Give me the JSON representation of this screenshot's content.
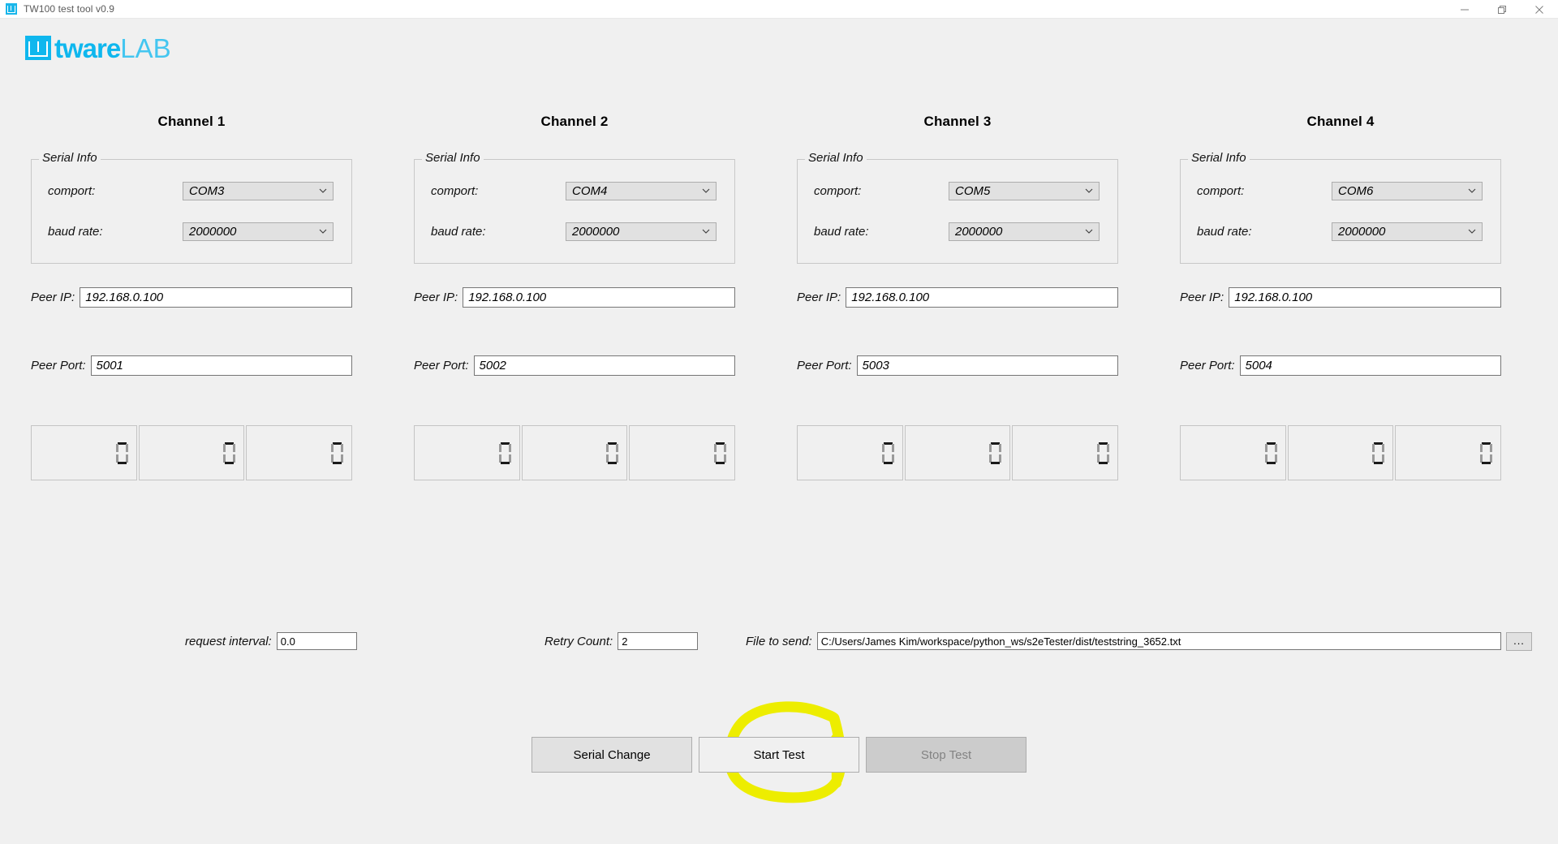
{
  "window": {
    "title": "TW100 test tool v0.9",
    "app_icon": "tw-logo-icon",
    "minimize_label": "minimize-icon",
    "maximize_label": "maximize-icon",
    "close_label": "close-icon"
  },
  "brand": {
    "mark": "tware-logo-icon",
    "name_bold": "tware",
    "name_light": "LAB",
    "color": "#0fb7ee"
  },
  "channels": [
    {
      "title": "Channel 1",
      "serial_info": {
        "legend": "Serial Info",
        "comport_label": "comport:",
        "comport_value": "COM3",
        "baud_label": "baud rate:",
        "baud_value": "2000000"
      },
      "peer_ip_label": "Peer IP:",
      "peer_ip_value": "192.168.0.100",
      "peer_port_label": "Peer Port:",
      "peer_port_value": "5001",
      "counters": [
        "0",
        "0",
        "0"
      ]
    },
    {
      "title": "Channel 2",
      "serial_info": {
        "legend": "Serial Info",
        "comport_label": "comport:",
        "comport_value": "COM4",
        "baud_label": "baud rate:",
        "baud_value": "2000000"
      },
      "peer_ip_label": "Peer IP:",
      "peer_ip_value": "192.168.0.100",
      "peer_port_label": "Peer Port:",
      "peer_port_value": "5002",
      "counters": [
        "0",
        "0",
        "0"
      ]
    },
    {
      "title": "Channel 3",
      "serial_info": {
        "legend": "Serial Info",
        "comport_label": "comport:",
        "comport_value": "COM5",
        "baud_label": "baud rate:",
        "baud_value": "2000000"
      },
      "peer_ip_label": "Peer IP:",
      "peer_ip_value": "192.168.0.100",
      "peer_port_label": "Peer Port:",
      "peer_port_value": "5003",
      "counters": [
        "0",
        "0",
        "0"
      ]
    },
    {
      "title": "Channel 4",
      "serial_info": {
        "legend": "Serial Info",
        "comport_label": "comport:",
        "comport_value": "COM6",
        "baud_label": "baud rate:",
        "baud_value": "2000000"
      },
      "peer_ip_label": "Peer IP:",
      "peer_ip_value": "192.168.0.100",
      "peer_port_label": "Peer Port:",
      "peer_port_value": "5004",
      "counters": [
        "0",
        "0",
        "0"
      ]
    }
  ],
  "settings": {
    "request_interval_label": "request interval:",
    "request_interval_value": "0.0",
    "retry_count_label": "Retry Count:",
    "retry_count_value": "2",
    "file_to_send_label": "File to send:",
    "file_to_send_value": "C:/Users/James Kim/workspace/python_ws/s2eTester/dist/teststring_3652.txt",
    "browse_label": "..."
  },
  "actions": {
    "serial_change": "Serial Change",
    "start_test": "Start Test",
    "stop_test": "Stop Test"
  },
  "annotation": {
    "type": "circle-and-strike",
    "target": "Start Test",
    "color": "#eded00"
  }
}
